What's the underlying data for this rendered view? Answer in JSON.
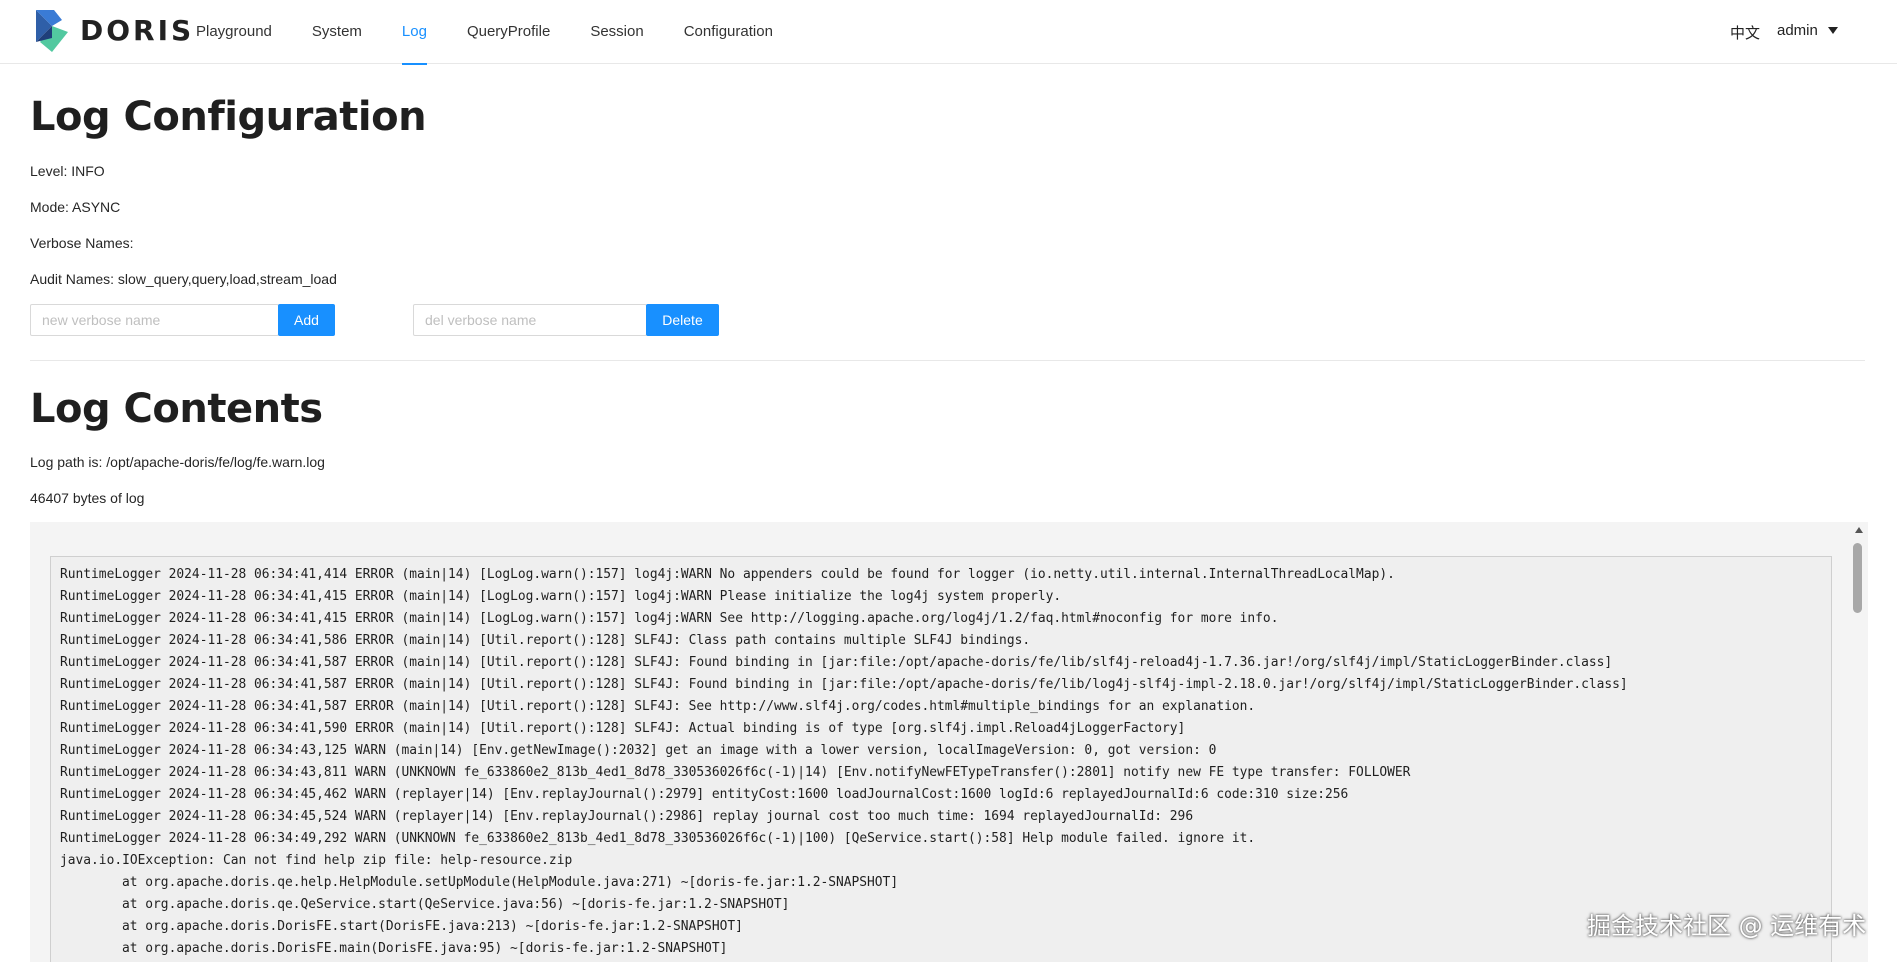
{
  "header": {
    "brand": "DORIS",
    "nav": [
      "Playground",
      "System",
      "Log",
      "QueryProfile",
      "Session",
      "Configuration"
    ],
    "active_tab": "Log",
    "language": "中文",
    "user": "admin"
  },
  "config": {
    "title": "Log Configuration",
    "level": "Level: INFO",
    "mode": "Mode: ASYNC",
    "verbose_names": "Verbose Names:",
    "audit_names": "Audit Names: slow_query,query,load,stream_load",
    "add_placeholder": "new verbose name",
    "add_label": "Add",
    "del_placeholder": "del verbose name",
    "delete_label": "Delete"
  },
  "contents": {
    "title": "Log Contents",
    "path": "Log path is: /opt/apache-doris/fe/log/fe.warn.log",
    "size": "46407 bytes of log",
    "lines": [
      "RuntimeLogger 2024-11-28 06:34:41,414 ERROR (main|14) [LogLog.warn():157] log4j:WARN No appenders could be found for logger (io.netty.util.internal.InternalThreadLocalMap).",
      "RuntimeLogger 2024-11-28 06:34:41,415 ERROR (main|14) [LogLog.warn():157] log4j:WARN Please initialize the log4j system properly.",
      "RuntimeLogger 2024-11-28 06:34:41,415 ERROR (main|14) [LogLog.warn():157] log4j:WARN See http://logging.apache.org/log4j/1.2/faq.html#noconfig for more info.",
      "RuntimeLogger 2024-11-28 06:34:41,586 ERROR (main|14) [Util.report():128] SLF4J: Class path contains multiple SLF4J bindings.",
      "RuntimeLogger 2024-11-28 06:34:41,587 ERROR (main|14) [Util.report():128] SLF4J: Found binding in [jar:file:/opt/apache-doris/fe/lib/slf4j-reload4j-1.7.36.jar!/org/slf4j/impl/StaticLoggerBinder.class]",
      "RuntimeLogger 2024-11-28 06:34:41,587 ERROR (main|14) [Util.report():128] SLF4J: Found binding in [jar:file:/opt/apache-doris/fe/lib/log4j-slf4j-impl-2.18.0.jar!/org/slf4j/impl/StaticLoggerBinder.class]",
      "RuntimeLogger 2024-11-28 06:34:41,587 ERROR (main|14) [Util.report():128] SLF4J: See http://www.slf4j.org/codes.html#multiple_bindings for an explanation.",
      "RuntimeLogger 2024-11-28 06:34:41,590 ERROR (main|14) [Util.report():128] SLF4J: Actual binding is of type [org.slf4j.impl.Reload4jLoggerFactory]",
      "RuntimeLogger 2024-11-28 06:34:43,125 WARN (main|14) [Env.getNewImage():2032] get an image with a lower version, localImageVersion: 0, got version: 0",
      "RuntimeLogger 2024-11-28 06:34:43,811 WARN (UNKNOWN fe_633860e2_813b_4ed1_8d78_330536026f6c(-1)|14) [Env.notifyNewFETypeTransfer():2801] notify new FE type transfer: FOLLOWER",
      "RuntimeLogger 2024-11-28 06:34:45,462 WARN (replayer|14) [Env.replayJournal():2979] entityCost:1600 loadJournalCost:1600 logId:6 replayedJournalId:6 code:310 size:256",
      "RuntimeLogger 2024-11-28 06:34:45,524 WARN (replayer|14) [Env.replayJournal():2986] replay journal cost too much time: 1694 replayedJournalId: 296",
      "RuntimeLogger 2024-11-28 06:34:49,292 WARN (UNKNOWN fe_633860e2_813b_4ed1_8d78_330536026f6c(-1)|100) [QeService.start():58] Help module failed. ignore it.",
      "java.io.IOException: Can not find help zip file: help-resource.zip",
      "at org.apache.doris.qe.help.HelpModule.setUpModule(HelpModule.java:271) ~[doris-fe.jar:1.2-SNAPSHOT]",
      "at org.apache.doris.qe.QeService.start(QeService.java:56) ~[doris-fe.jar:1.2-SNAPSHOT]",
      "at org.apache.doris.DorisFE.start(DorisFE.java:213) ~[doris-fe.jar:1.2-SNAPSHOT]",
      "at org.apache.doris.DorisFE.main(DorisFE.java:95) ~[doris-fe.jar:1.2-SNAPSHOT]"
    ]
  },
  "watermark": "掘金技术社区 @ 运维有术",
  "colors": {
    "accent": "#1890ff",
    "logo_top": "#3a7bd5",
    "logo_bottom": "#52c9a0"
  }
}
